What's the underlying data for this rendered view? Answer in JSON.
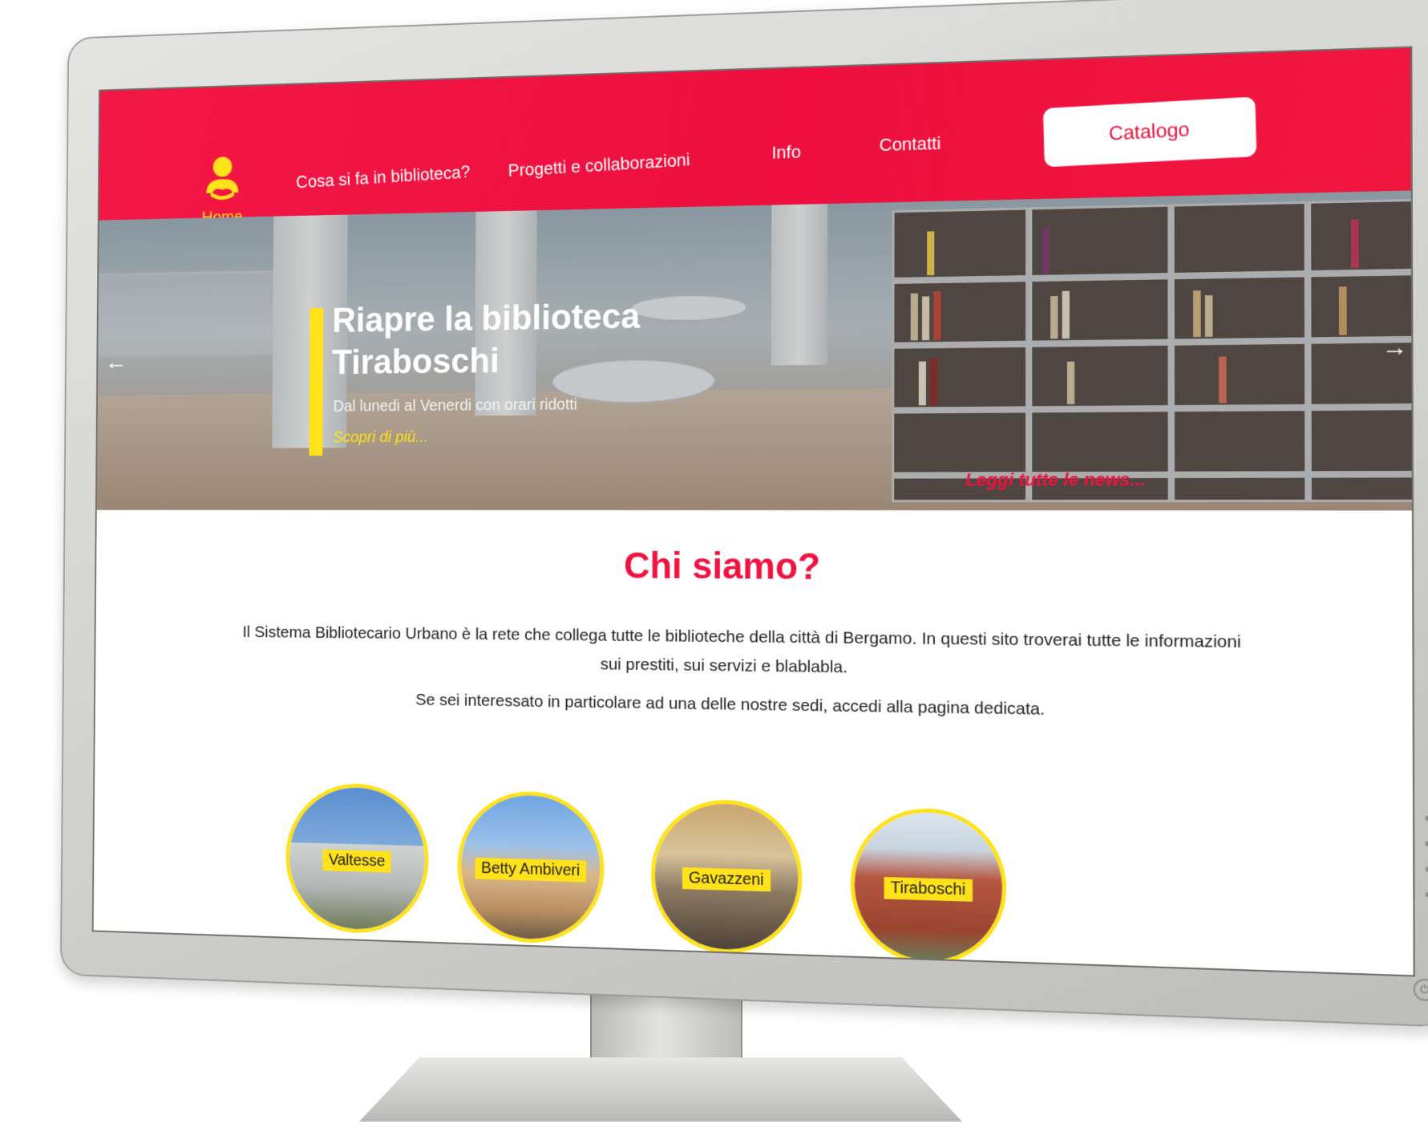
{
  "header": {
    "home_label": "Home",
    "nav": [
      "Cosa si fa in biblioteca?",
      "Progetti e collaborazioni",
      "Info",
      "Contatti"
    ],
    "catalog_label": "Catalogo"
  },
  "hero": {
    "title_line1": "Riapre la biblioteca",
    "title_line2": "Tiraboschi",
    "subtitle": "Dal lunedi al Venerdi con orari ridotti",
    "more_link": "Scopri di più...",
    "news_link": "Leggi tutte le news..."
  },
  "about": {
    "title": "Chi siamo?",
    "paragraph1": "Il Sistema Bibliotecario Urbano è la rete che collega tutte le biblioteche della città di Bergamo. In questi sito troverai tutte le informazioni sui prestiti, sui servizi e blablabla.",
    "paragraph2": "Se sei interessato in particolare ad una delle nostre sedi, accedi alla pagina dedicata."
  },
  "branches": [
    "Valtesse",
    "Betty Ambiveri",
    "Gavazzeni",
    "Tiraboschi"
  ],
  "colors": {
    "brand_red": "#ee1340",
    "brand_yellow": "#ffe21a"
  }
}
